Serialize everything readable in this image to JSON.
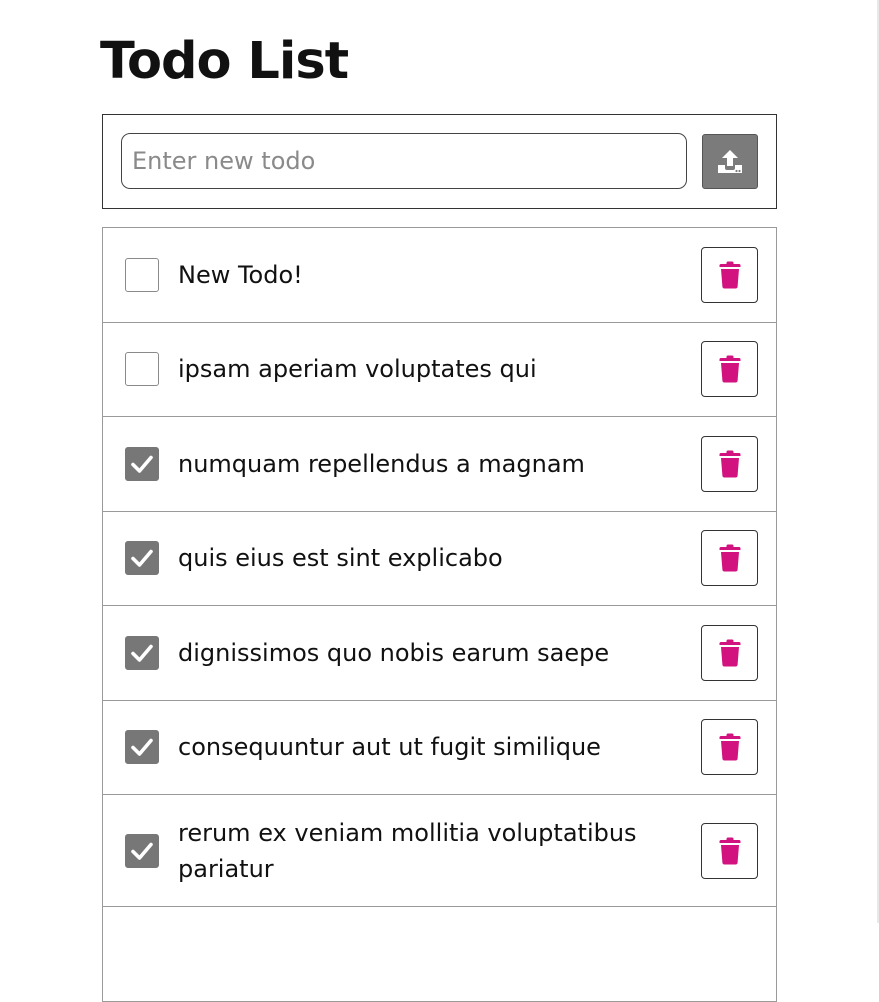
{
  "title": "Todo List",
  "new_todo": {
    "value": "",
    "placeholder": "Enter new todo",
    "submit_icon": "upload-icon"
  },
  "colors": {
    "delete_icon": "#d1127f",
    "checked_box": "#777777",
    "submit_button": "#7b7b7b"
  },
  "todos": [
    {
      "text": "New Todo!",
      "completed": false,
      "delete_icon": "trash-icon"
    },
    {
      "text": "ipsam aperiam voluptates qui",
      "completed": false,
      "delete_icon": "trash-icon"
    },
    {
      "text": "numquam repellendus a magnam",
      "completed": true,
      "delete_icon": "trash-icon"
    },
    {
      "text": "quis eius est sint explicabo",
      "completed": true,
      "delete_icon": "trash-icon"
    },
    {
      "text": "dignissimos quo nobis earum saepe",
      "completed": true,
      "delete_icon": "trash-icon"
    },
    {
      "text": "consequuntur aut ut fugit similique",
      "completed": true,
      "delete_icon": "trash-icon"
    },
    {
      "text": "rerum ex veniam mollitia voluptatibus pariatur",
      "completed": true,
      "delete_icon": "trash-icon"
    }
  ]
}
